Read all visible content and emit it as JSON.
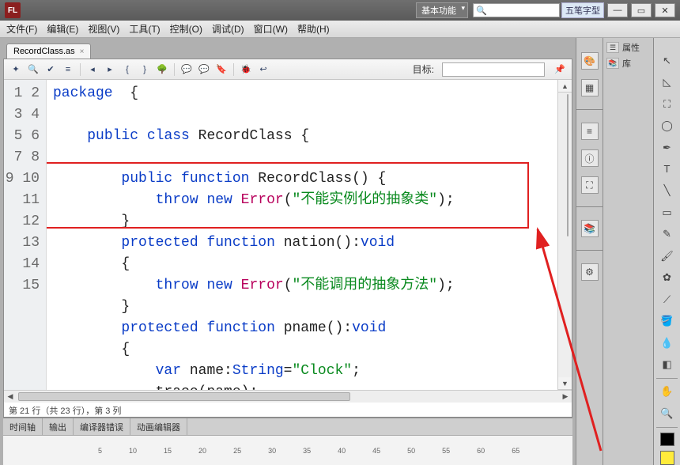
{
  "title": {
    "logo": "FL",
    "dropdown": "基本功能",
    "ime": "五笔字型"
  },
  "window_buttons": {
    "min": "—",
    "max": "▭",
    "close": "✕"
  },
  "menu": [
    "文件(F)",
    "编辑(E)",
    "视图(V)",
    "工具(T)",
    "控制(O)",
    "调试(D)",
    "窗口(W)",
    "帮助(H)"
  ],
  "doc_tab": {
    "name": "RecordClass.as",
    "close": "×"
  },
  "editor_toolbar": {
    "target_label": "目标:",
    "icons": [
      "edit",
      "find",
      "check",
      "indent",
      "brace-left",
      "brace-right",
      "tree",
      "keyword",
      "comment",
      "uncomment",
      "bookmark",
      "debug",
      "wrap"
    ]
  },
  "code": {
    "lines": [
      1,
      2,
      3,
      4,
      5,
      6,
      7,
      8,
      9,
      10,
      11,
      12,
      13,
      14,
      15
    ],
    "l1": {
      "kw": "package",
      "b": "{"
    },
    "l3": {
      "kw1": "public",
      "kw2": "class",
      "name": "RecordClass",
      "b": "{"
    },
    "l5": {
      "kw1": "public",
      "kw2": "function",
      "name": "RecordClass()",
      "b": "{"
    },
    "l6": {
      "kw1": "throw",
      "kw2": "new",
      "err": "Error",
      "s": "\"不能实例化的抽象类\""
    },
    "l7": {
      "b": "}"
    },
    "l8": {
      "kw1": "protected",
      "kw2": "function",
      "name": "nation():",
      "ret": "void"
    },
    "l9": {
      "b": "{"
    },
    "l10": {
      "kw1": "throw",
      "kw2": "new",
      "err": "Error",
      "s": "\"不能调用的抽象方法\""
    },
    "l11": {
      "b": "}"
    },
    "l12": {
      "kw1": "protected",
      "kw2": "function",
      "name": "pname():",
      "ret": "void"
    },
    "l13": {
      "b": "{"
    },
    "l14": {
      "kw": "var",
      "name": "name:",
      "typ": "String",
      "eq": "=",
      "s": "\"Clock\"",
      "semi": ";"
    },
    "l15": {
      "txt": "trace(name);"
    }
  },
  "status": "第 21 行（共 23 行），第 3 列",
  "bottom_tabs": [
    "时间轴",
    "输出",
    "编译器错误",
    "动画编辑器"
  ],
  "timeline_marks": [
    "5",
    "10",
    "15",
    "20",
    "25",
    "30",
    "35",
    "40",
    "45",
    "50",
    "55",
    "60",
    "65"
  ],
  "right_panel": {
    "prop": "属性",
    "lib": "库"
  }
}
